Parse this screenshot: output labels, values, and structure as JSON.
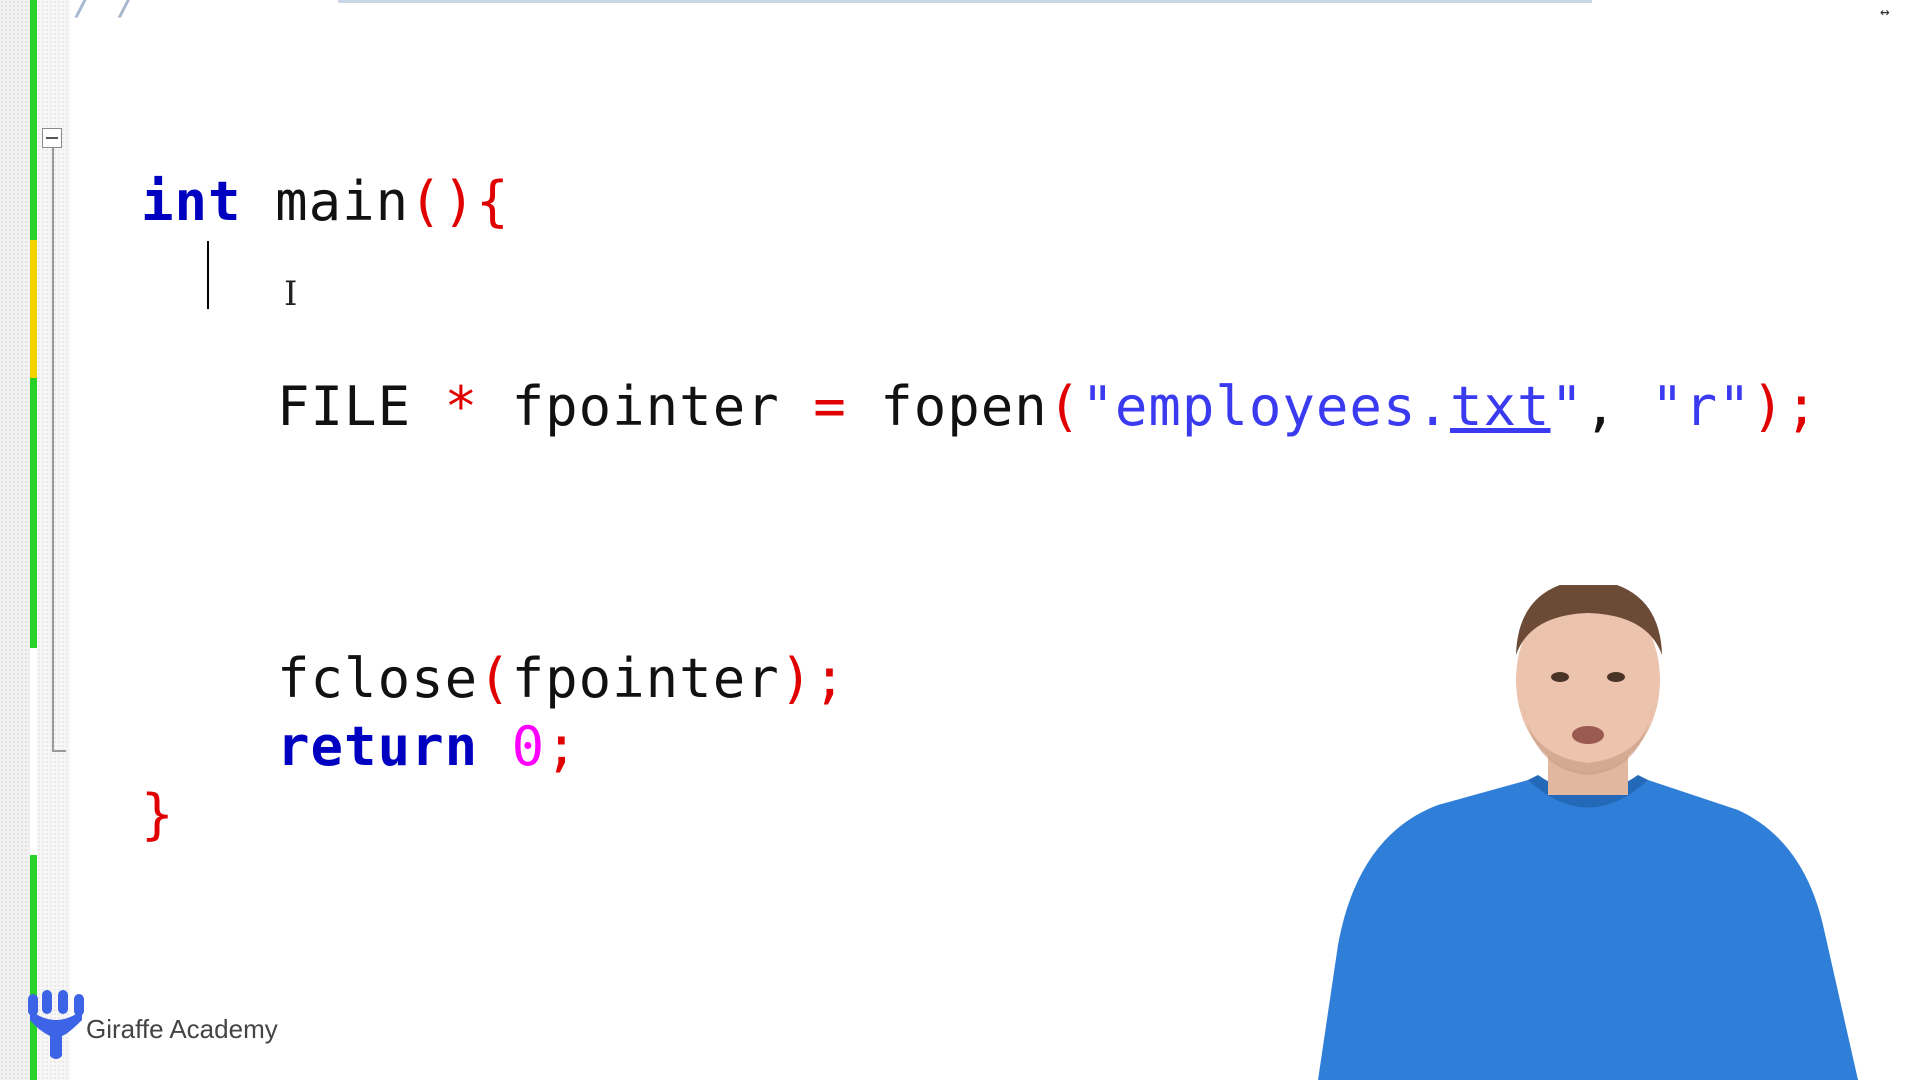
{
  "editor": {
    "top_comment": "/ /",
    "resize_glyph": "↔",
    "lines": [
      {
        "kw": "int",
        "rest": " main",
        "punct": "(){"
      },
      {
        "caret": true
      },
      {
        "type": "FILE",
        "star": " * ",
        "var": "fpointer",
        "eq": " = ",
        "fn": "fopen",
        "open": "(",
        "str1_pre": "\"employees.",
        "str1_link": "txt",
        "str1_post": "\"",
        "comma": ", ",
        "str2": "\"r\"",
        "close": ");"
      },
      {
        "fn": "fclose",
        "open": "(",
        "arg": "fpointer",
        "close": ");"
      },
      {
        "kw": "return",
        "num": "0",
        "semi": ";"
      },
      {
        "brace": "}"
      }
    ]
  },
  "branding": {
    "logo_text": "Giraffe Academy",
    "logo_color": "#3d63e6"
  },
  "colors": {
    "keyword": "#0000c0",
    "operator": "#e00000",
    "string": "#3a3af0",
    "number": "#ff00ff",
    "change_green": "#28d228",
    "change_yellow": "#f5d200"
  }
}
